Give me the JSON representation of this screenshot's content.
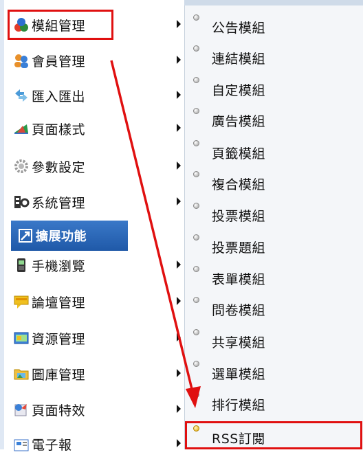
{
  "main_menu": {
    "items": [
      {
        "label": "模組管理",
        "icon": "modules-icon",
        "has_submenu": true,
        "highlighted": true
      },
      {
        "label": "會員管理",
        "icon": "members-icon",
        "has_submenu": true
      },
      {
        "label": "匯入匯出",
        "icon": "import-export-icon",
        "has_submenu": true
      },
      {
        "label": "頁面樣式",
        "icon": "page-style-icon",
        "has_submenu": true
      },
      {
        "label": "參數設定",
        "icon": "gear-icon",
        "has_submenu": true
      },
      {
        "label": "系統管理",
        "icon": "system-icon",
        "has_submenu": true
      },
      {
        "label": "擴展功能",
        "icon": "expand-icon",
        "has_submenu": false,
        "selected": true
      },
      {
        "label": "手機瀏覽",
        "icon": "mobile-icon",
        "has_submenu": true
      },
      {
        "label": "論壇管理",
        "icon": "forum-icon",
        "has_submenu": true
      },
      {
        "label": "資源管理",
        "icon": "resource-icon",
        "has_submenu": true
      },
      {
        "label": "圖庫管理",
        "icon": "gallery-icon",
        "has_submenu": true
      },
      {
        "label": "頁面特效",
        "icon": "effects-icon",
        "has_submenu": true
      },
      {
        "label": "電子報",
        "icon": "newsletter-icon",
        "has_submenu": true
      }
    ]
  },
  "sub_menu": {
    "items": [
      {
        "label": "公告模組"
      },
      {
        "label": "連結模組"
      },
      {
        "label": "自定模組"
      },
      {
        "label": "廣告模組"
      },
      {
        "label": "頁籤模組"
      },
      {
        "label": "複合模組"
      },
      {
        "label": "投票模組"
      },
      {
        "label": "投票題組"
      },
      {
        "label": "表單模組"
      },
      {
        "label": "問卷模組"
      },
      {
        "label": "共享模組"
      },
      {
        "label": "選單模組"
      },
      {
        "label": "排行模組"
      },
      {
        "label": "RSS訂閱",
        "highlighted": true
      }
    ]
  },
  "colors": {
    "highlight_border": "#e01010",
    "arrow": "#e01010",
    "selected_bg": "#2a66b8"
  }
}
